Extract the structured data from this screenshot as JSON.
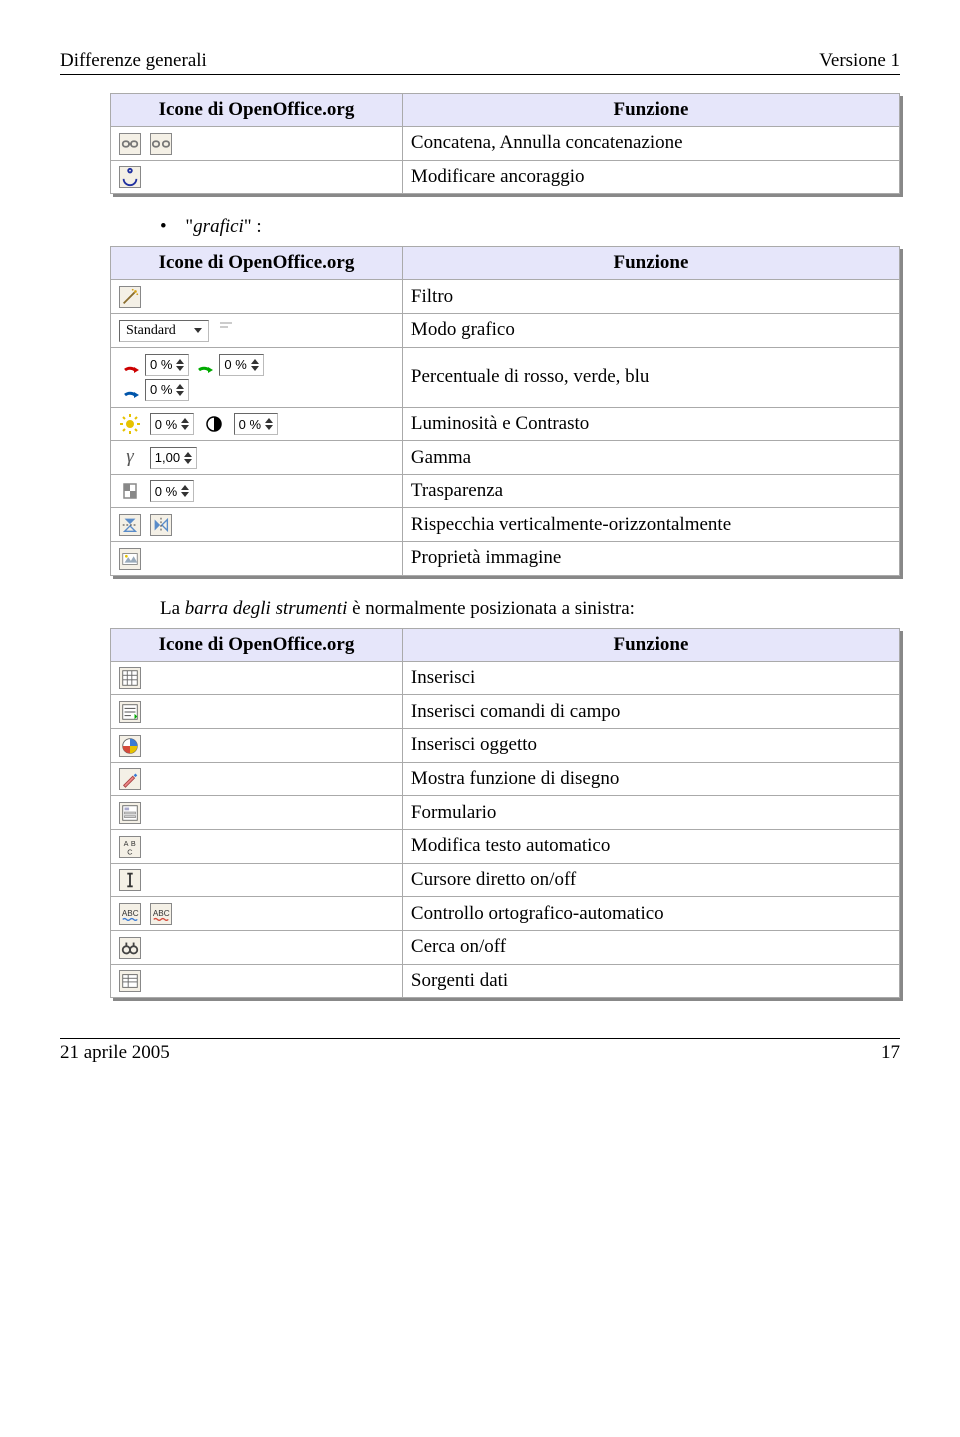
{
  "header": {
    "left": "Differenze generali",
    "right": "Versione 1"
  },
  "table1": {
    "head_left": "Icone di OpenOffice.org",
    "head_right": "Funzione",
    "rows": [
      {
        "label": "Concatena, Annulla concatenazione"
      },
      {
        "label": "Modificare ancoraggio"
      }
    ]
  },
  "bullet": {
    "prefix": "\"",
    "word": "grafici",
    "suffix": "\" :"
  },
  "table2": {
    "head_left": "Icone di OpenOffice.org",
    "head_right": "Funzione",
    "rows": [
      {
        "label": "Filtro"
      },
      {
        "label": "Modo grafico",
        "dropdown_value": "Standard"
      },
      {
        "label": "Percentuale di rosso, verde, blu",
        "pct": "0 %"
      },
      {
        "label": "Luminosità e Contrasto",
        "pct": "0 %"
      },
      {
        "label": "Gamma",
        "gamma_value": "1,00"
      },
      {
        "label": "Trasparenza",
        "pct": "0 %"
      },
      {
        "label": "Rispecchia verticalmente-orizzontalmente"
      },
      {
        "label": "Proprietà immagine"
      }
    ]
  },
  "midtext": {
    "pre": "La ",
    "ital": "barra degli strumenti",
    "post": " è normalmente posizionata a sinistra:"
  },
  "table3": {
    "head_left": "Icone di OpenOffice.org",
    "head_right": "Funzione",
    "rows": [
      {
        "label": "Inserisci"
      },
      {
        "label": "Inserisci comandi di campo"
      },
      {
        "label": "Inserisci oggetto"
      },
      {
        "label": "Mostra funzione di disegno"
      },
      {
        "label": "Formulario"
      },
      {
        "label": "Modifica testo automatico"
      },
      {
        "label": "Cursore diretto on/off"
      },
      {
        "label": "Controllo ortografico-automatico"
      },
      {
        "label": "Cerca on/off"
      },
      {
        "label": "Sorgenti dati"
      }
    ]
  },
  "footer": {
    "left": "21 aprile 2005",
    "right": "17"
  }
}
